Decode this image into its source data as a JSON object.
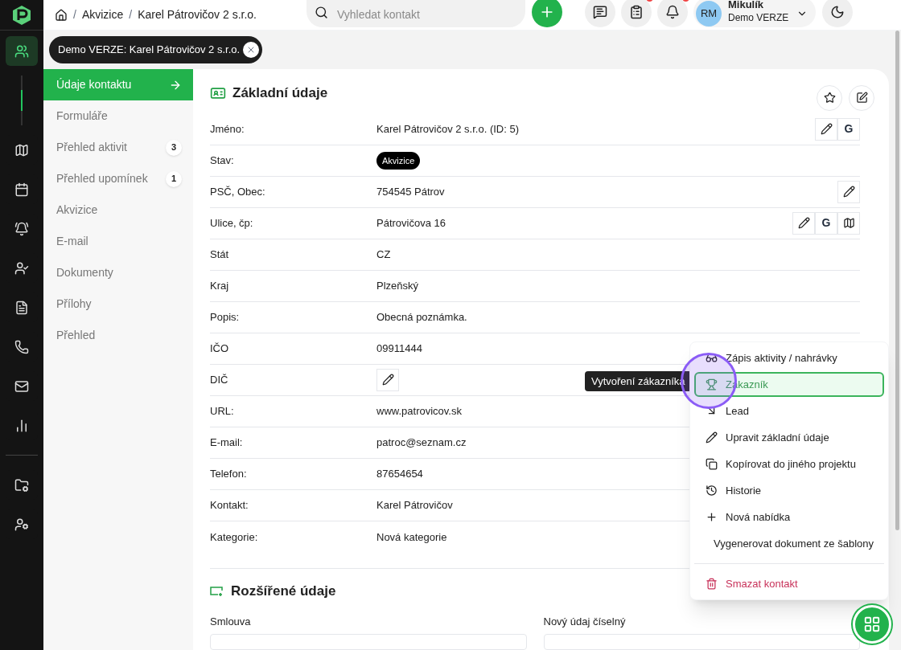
{
  "rail": [
    {
      "kind": "users",
      "selected": true
    },
    {
      "kind": "map",
      "selected": false
    },
    {
      "kind": "calendar",
      "selected": false
    },
    {
      "kind": "bell",
      "selected": false
    },
    {
      "kind": "user-key",
      "selected": false
    },
    {
      "kind": "file",
      "selected": false
    },
    {
      "kind": "phone",
      "selected": false
    },
    {
      "kind": "mail",
      "selected": false
    },
    {
      "kind": "chart",
      "selected": false
    }
  ],
  "rail_bottom": [
    {
      "kind": "folder-settings",
      "selected": false
    },
    {
      "kind": "user-settings",
      "selected": false
    }
  ],
  "breadcrumbs": [
    "Akvizice",
    "Karel Pátrovičov 2 s.r.o."
  ],
  "breadcrumb_separator": "/",
  "search": {
    "placeholder": "Vyhledat kontakt"
  },
  "header_buttons": [
    {
      "kind": "chat",
      "badge": false
    },
    {
      "kind": "clipboard",
      "badge": true
    },
    {
      "kind": "bell",
      "badge": true
    }
  ],
  "user": {
    "initials": "RM",
    "name": "Mikulík",
    "project": "Demo VERZE"
  },
  "tab_chip": {
    "label": "Demo VERZE: Karel Pátrovičov 2 s.r.o."
  },
  "nav": [
    {
      "label": "Údaje kontaktu",
      "selected": true
    },
    {
      "label": "Formuláře",
      "selected": false
    },
    {
      "label": "Přehled aktivit",
      "selected": false,
      "count": "3"
    },
    {
      "label": "Přehled upomínek",
      "selected": false,
      "count": "1"
    },
    {
      "label": "Akvizice",
      "selected": false
    },
    {
      "label": "E-mail",
      "selected": false
    },
    {
      "label": "Dokumenty",
      "selected": false
    },
    {
      "label": "Přílohy",
      "selected": false
    },
    {
      "label": "Přehled",
      "selected": false
    }
  ],
  "basic": {
    "title": "Základní údaje",
    "rows": [
      {
        "label": "Jméno:",
        "kind": "text",
        "value": "Karel Pátrovičov 2 s.r.o. (ID: 5)",
        "actions": [
          {
            "kind": "edit"
          },
          {
            "kind": "google",
            "label": "G"
          }
        ]
      },
      {
        "label": "Stav:",
        "kind": "badge",
        "value": "Akvizice"
      },
      {
        "label": "PSČ, Obec:",
        "kind": "text",
        "value": "754545 Pátrov",
        "actions": [
          {
            "kind": "edit"
          }
        ]
      },
      {
        "label": "Ulice, čp:",
        "kind": "text",
        "value": "Pátrovičova 16",
        "actions": [
          {
            "kind": "edit"
          },
          {
            "kind": "google",
            "label": "G"
          },
          {
            "kind": "map"
          }
        ]
      },
      {
        "label": "Stát",
        "kind": "text",
        "value": "CZ"
      },
      {
        "label": "Kraj",
        "kind": "text",
        "value": "Plzeňský"
      },
      {
        "label": "Popis:",
        "kind": "text",
        "value": "Obecná poznámka."
      },
      {
        "label": "IČO",
        "kind": "text",
        "value": "09911444"
      },
      {
        "label": "DIČ",
        "kind": "edit"
      },
      {
        "label": "URL:",
        "kind": "text",
        "value": "www.patrovicov.sk"
      },
      {
        "label": "E-mail:",
        "kind": "text",
        "value": "patroc@seznam.cz"
      },
      {
        "label": "Telefon:",
        "kind": "text",
        "value": "87654654"
      },
      {
        "label": "Kontakt:",
        "kind": "text",
        "value": "Karel Pátrovičov"
      },
      {
        "label": "Kategorie:",
        "kind": "text",
        "value": "Nová kategorie"
      }
    ]
  },
  "extended": {
    "title": "Rozšířené údaje",
    "fields": [
      "Smlouva",
      "Nový údaj číselný"
    ]
  },
  "menu": {
    "items": [
      {
        "kind": "activity",
        "label": "Zápis aktivity / nahrávky",
        "selected": false
      },
      {
        "kind": "customer",
        "label": "Zákazník",
        "selected": true
      },
      {
        "kind": "lead",
        "label": "Lead",
        "selected": false
      },
      {
        "kind": "edit",
        "label": "Upravit základní údaje",
        "selected": false
      },
      {
        "kind": "copy",
        "label": "Kopírovat do jiného projektu",
        "selected": false
      },
      {
        "kind": "history",
        "label": "Historie",
        "selected": false
      },
      {
        "kind": "offer",
        "label": "Nová nabídka",
        "selected": false
      },
      {
        "kind": "template",
        "label": "Vygenerovat dokument ze šablony",
        "selected": false
      },
      {
        "kind": "delete",
        "label": "Smazat kontakt",
        "selected": false
      }
    ]
  },
  "tooltip": "Vytvoření zákazníka"
}
